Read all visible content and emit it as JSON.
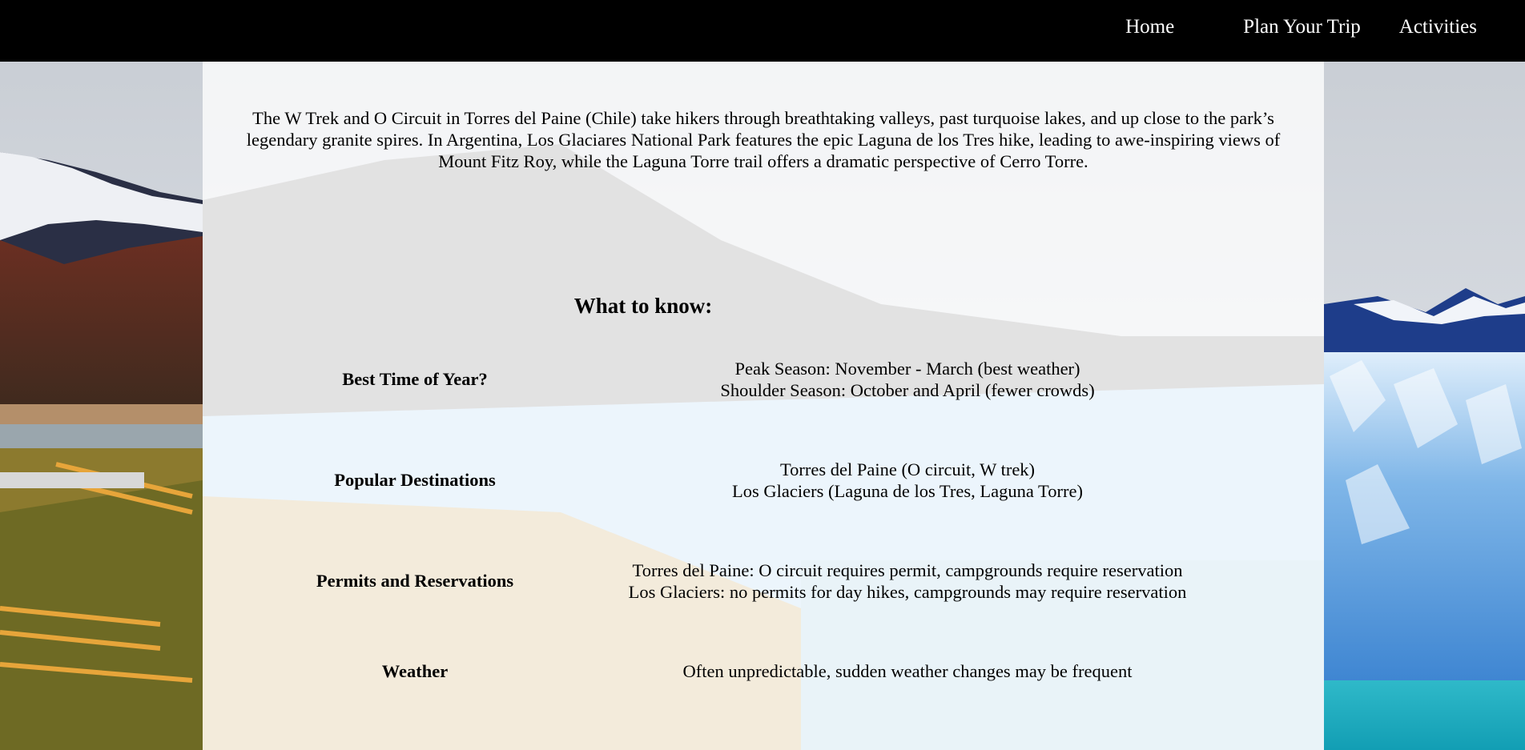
{
  "nav": {
    "home": "Home",
    "plan": "Plan Your Trip",
    "activities": "Activities"
  },
  "intro": "The W Trek and O Circuit in Torres del Paine (Chile) take hikers through breathtaking valleys, past turquoise lakes, and up close to the park’s legendary granite spires. In Argentina, Los Glaciares National Park features the epic Laguna de los Tres hike, leading to awe-inspiring views of Mount Fitz Roy, while the Laguna Torre trail offers a dramatic perspective of Cerro Torre.",
  "what_to_know": {
    "title": "What to know:",
    "rows": [
      {
        "label": "Best Time of Year?",
        "line1": "Peak Season: November - March (best weather)",
        "line2": "Shoulder Season: October and April (fewer crowds)"
      },
      {
        "label": "Popular Destinations",
        "line1": "Torres del Paine (O circuit, W trek)",
        "line2": "Los Glaciers (Laguna de los Tres, Laguna Torre)"
      },
      {
        "label": "Permits and Reservations",
        "line1": "Torres del Paine: O circuit requires permit, campgrounds require reservation",
        "line2": "Los Glaciers: no permits for day hikes, campgrounds may require reservation"
      },
      {
        "label": "Weather",
        "line1": "Often unpredictable, sudden weather changes may be frequent",
        "line2": ""
      }
    ]
  }
}
